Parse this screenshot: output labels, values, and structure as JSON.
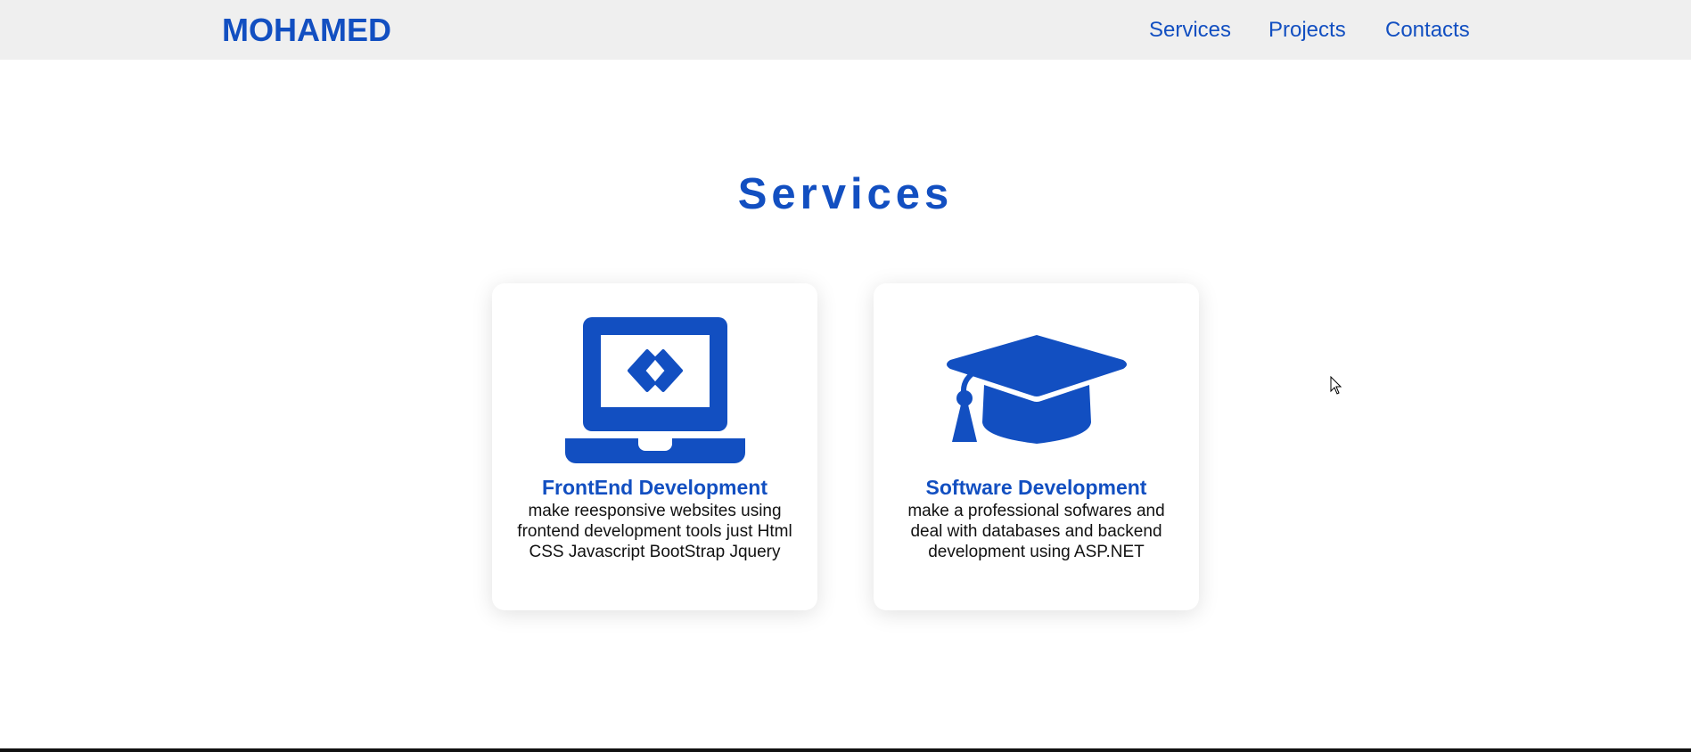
{
  "header": {
    "brand": "MOHAMED",
    "nav": [
      {
        "label": "Services"
      },
      {
        "label": "Projects"
      },
      {
        "label": "Contacts"
      }
    ]
  },
  "services": {
    "title": "Services",
    "cards": [
      {
        "icon": "laptop-code-icon",
        "title": "FrontEnd Development",
        "text": "make reesponsive websites using frontend development tools just Html CSS Javascript BootStrap Jquery"
      },
      {
        "icon": "graduation-cap-icon",
        "title": "Software Development",
        "text": "make a professional sofwares and deal with databases and backend development using ASP.NET"
      }
    ]
  },
  "colors": {
    "accent": "#124fc1",
    "navbar_bg": "#efefef",
    "text": "#111111"
  }
}
